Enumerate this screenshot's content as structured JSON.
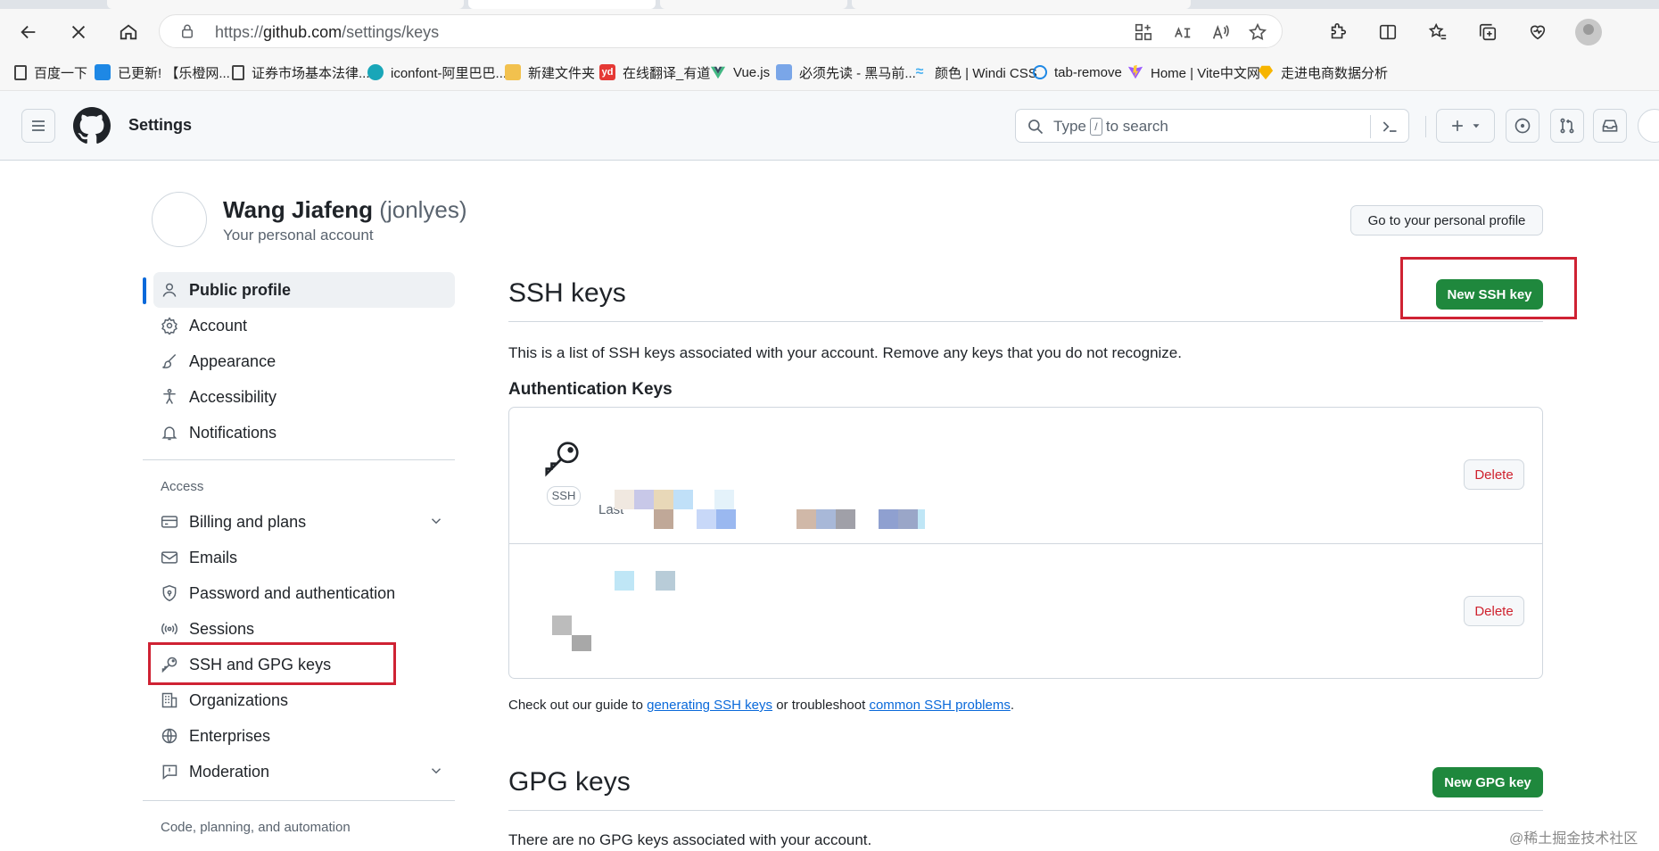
{
  "browser": {
    "url_prefix": "https://",
    "url_host": "github.com",
    "url_path": "/settings/keys",
    "bookmarks": [
      {
        "label": "百度一下",
        "icon": "page-icon",
        "color": "#444444"
      },
      {
        "label": "已更新! 【乐橙网...",
        "icon": "tv-icon",
        "color": "#1e88e5"
      },
      {
        "label": "证券市场基本法律...",
        "icon": "page-icon",
        "color": "#444444"
      },
      {
        "label": "iconfont-阿里巴巴...",
        "icon": "iconfont-icon",
        "color": "#19a6b8"
      },
      {
        "label": "新建文件夹",
        "icon": "folder-icon",
        "color": "#f2c14e"
      },
      {
        "label": "在线翻译_有道",
        "icon": "youdao-icon",
        "color": "#e53935"
      },
      {
        "label": "Vue.js",
        "icon": "vue-icon",
        "color": "#42b883"
      },
      {
        "label": "必须先读 - 黑马前...",
        "icon": "image-icon",
        "color": "#7aa6e8"
      },
      {
        "label": "颜色 | Windi CSS",
        "icon": "windi-icon",
        "color": "#48b0f1"
      },
      {
        "label": "tab-remove",
        "icon": "tab-remove-icon",
        "color": "#1e88e5"
      },
      {
        "label": "Home | Vite中文网",
        "icon": "vite-icon",
        "color": "#9b59ff"
      },
      {
        "label": "走进电商数据分析",
        "icon": "sketch-icon",
        "color": "#f7b500"
      }
    ]
  },
  "header": {
    "context": "Settings",
    "search_prefix": "Type",
    "search_key": "/",
    "search_suffix": "to search"
  },
  "profile": {
    "name": "Wang Jiafeng",
    "login": "(jonlyes)",
    "subtitle": "Your personal account",
    "go_profile_label": "Go to your personal profile"
  },
  "sidebar": {
    "items_top": [
      {
        "label": "Public profile",
        "icon": "person-icon",
        "active": true
      },
      {
        "label": "Account",
        "icon": "gear-icon"
      },
      {
        "label": "Appearance",
        "icon": "paintbrush-icon"
      },
      {
        "label": "Accessibility",
        "icon": "accessibility-icon"
      },
      {
        "label": "Notifications",
        "icon": "bell-icon"
      }
    ],
    "access_heading": "Access",
    "items_access": [
      {
        "label": "Billing and plans",
        "icon": "credit-card-icon",
        "expandable": true
      },
      {
        "label": "Emails",
        "icon": "mail-icon"
      },
      {
        "label": "Password and authentication",
        "icon": "shield-lock-icon"
      },
      {
        "label": "Sessions",
        "icon": "broadcast-icon"
      },
      {
        "label": "SSH and GPG keys",
        "icon": "key-icon"
      },
      {
        "label": "Organizations",
        "icon": "organization-icon"
      },
      {
        "label": "Enterprises",
        "icon": "globe-icon"
      },
      {
        "label": "Moderation",
        "icon": "report-icon",
        "expandable": true
      }
    ],
    "code_heading": "Code, planning, and automation"
  },
  "main": {
    "ssh_title": "SSH keys",
    "new_ssh_label": "New SSH key",
    "ssh_description": "This is a list of SSH keys associated with your account. Remove any keys that you do not recognize.",
    "auth_title": "Authentication Keys",
    "keys": [
      {
        "badge": "SSH",
        "last_used": "Last",
        "delete_label": "Delete"
      },
      {
        "delete_label": "Delete"
      }
    ],
    "guide_prefix": "Check out our guide to",
    "guide_link1": "generating SSH keys",
    "guide_middle": "or troubleshoot",
    "guide_link2": "common SSH problems",
    "guide_suffix": ".",
    "gpg_title": "GPG keys",
    "new_gpg_label": "New GPG key",
    "gpg_description": "There are no GPG keys associated with your account."
  },
  "watermark": "@稀土掘金技术社区",
  "colors": {
    "primary_green": "#1f883d",
    "danger_red": "#cf222e",
    "link_blue": "#0969da",
    "highlight_red": "#cf2233"
  }
}
